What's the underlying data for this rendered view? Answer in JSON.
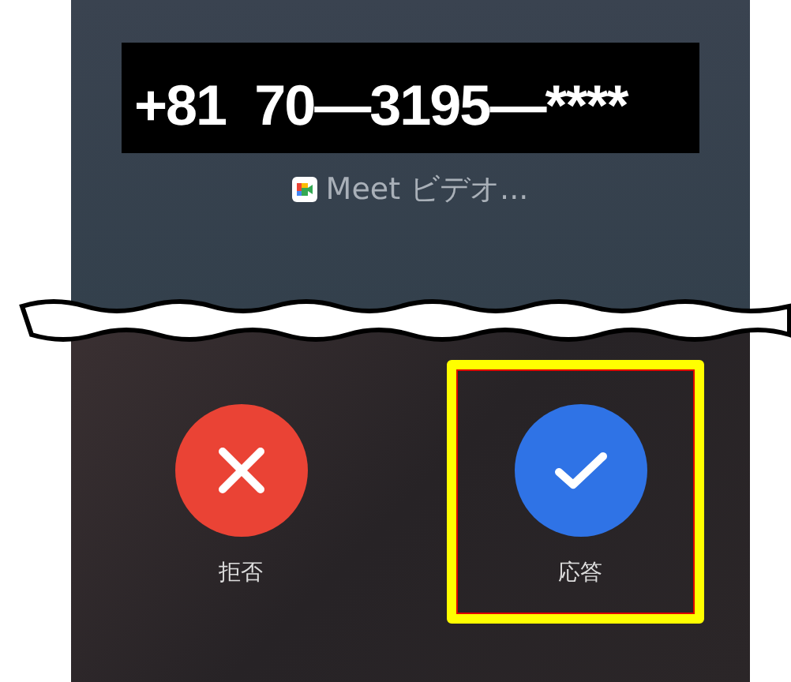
{
  "caller": {
    "number": "+81  70—3195—****",
    "app_label": "Meet ビデオ..."
  },
  "actions": [
    {
      "kind": "decline",
      "label": "拒否",
      "highlighted": false
    },
    {
      "kind": "accept",
      "label": "応答",
      "highlighted": true
    }
  ]
}
